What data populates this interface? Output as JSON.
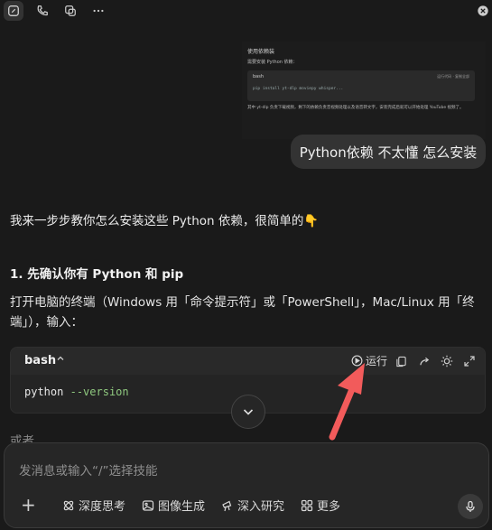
{
  "toolbar": {
    "icons": [
      "compose-icon",
      "phone-icon",
      "copy-icon",
      "more-icon",
      "close-icon"
    ]
  },
  "screenshot": {
    "heading": "使用依赖装",
    "subtext": "需要安装 Python 依赖：",
    "code_lang": "bash",
    "code_actions": "运行代码 · 复制全部",
    "code_line": "pip install yt-dlp moviepy whisper...",
    "paragraph": "其中 yt-dlp 负责下载视频，剩下的依赖负责音视频处理以及语音转文字，安装完成后就可以开始处理 YouTube 视频了。"
  },
  "user_message": "Python依赖 不太懂 怎么安装",
  "assistant": {
    "intro": "我来一步步教你怎么安装这些 Python 依赖，很简单的👇",
    "step1_title": "1. 先确认你有 Python 和 pip",
    "step1_text": "打开电脑的终端（Windows 用「命令提示符」或「PowerShell」，Mac/Linux 用「终端」），输入：",
    "code": {
      "lang": "bash",
      "collapse_glyph": "^",
      "run_label": "运行",
      "command": "python",
      "flag": "--version"
    },
    "faded_text": "或者"
  },
  "input": {
    "placeholder": "发消息或输入“/”选择技能",
    "plus": "+",
    "tools": [
      {
        "label": "深度思考",
        "icon": "deep-think-icon"
      },
      {
        "label": "图像生成",
        "icon": "image-icon"
      },
      {
        "label": "深入研究",
        "icon": "research-icon"
      },
      {
        "label": "更多",
        "icon": "grid-icon"
      }
    ]
  },
  "colors": {
    "background": "#1a1a1a",
    "bubble": "#333333",
    "arrow": "#f25b5b",
    "code_flag": "#8fc97f"
  }
}
